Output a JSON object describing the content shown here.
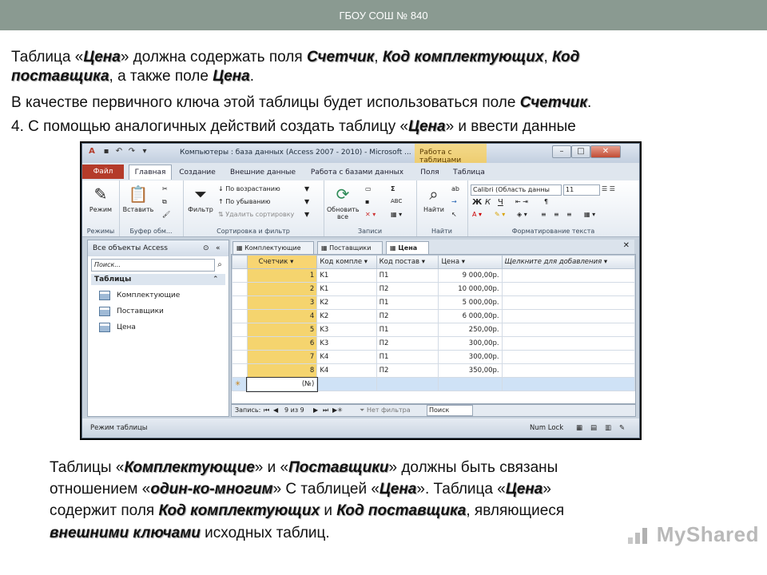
{
  "slide": {
    "header": "ГБОУ СОШ № 840",
    "intro": {
      "l1": [
        "Таблица «",
        "Цена",
        "» должна содержать поля ",
        "Счетчик",
        ", ",
        "Код комплектующих",
        ", ",
        "Код"
      ],
      "l2": [
        "поставщика",
        ", а также поле ",
        "Цена",
        "."
      ],
      "l3": [
        "В качестве первичного ключа этой таблицы будет использоваться поле ",
        "Счетчик",
        "."
      ],
      "l4": [
        " 4. С помощью аналогичных действий создать таблицу «",
        "Цена",
        "» и ввести данные"
      ]
    },
    "outro": {
      "l1": [
        "Таблицы «",
        "Комплектующие",
        "» и «",
        "Поставщики",
        "» должны быть связаны"
      ],
      "l2": [
        "отношением «",
        "один-ко-многим",
        "» С таблицей «",
        "Цена",
        "». Таблица «",
        "Цена",
        "»"
      ],
      "l3": [
        "содержит поля ",
        "Код комплектующих",
        " и ",
        "Код поставщика",
        ", являющиеся"
      ],
      "l4": [
        "внешними ключами",
        " исходных таблиц."
      ]
    },
    "watermark": "MyShared"
  },
  "access": {
    "title": "Компьютеры : база данных (Access 2007 - 2010) - Microsoft ...",
    "context_tab": "Работа с таблицами",
    "tabs": [
      "Файл",
      "Главная",
      "Создание",
      "Внешние данные",
      "Работа с базами данных",
      "Поля",
      "Таблица"
    ],
    "ribbon": {
      "views": {
        "button": "Режим",
        "group": "Режимы"
      },
      "clipboard": {
        "button": "Вставить",
        "group": "Буфер обм..."
      },
      "sort": {
        "filter": "Фильтр",
        "asc": "По возрастанию",
        "desc": "По убыванию",
        "remove": "Удалить сортировку",
        "group": "Сортировка и фильтр"
      },
      "records": {
        "refresh": "Обновить",
        "all": "все",
        "group": "Записи",
        "sum": "Σ",
        "abc": "ABC"
      },
      "find": {
        "button": "Найти",
        "group": "Найти"
      },
      "format": {
        "font": "Calibri (Область данны",
        "size": "11",
        "bold": "Ж",
        "italic": "К",
        "underline": "Ч",
        "group": "Форматирование текста"
      }
    },
    "nav": {
      "header": "Все объекты Access",
      "search_placeholder": "Поиск...",
      "group": "Таблицы",
      "items": [
        "Комплектующие",
        "Поставщики",
        "Цена"
      ]
    },
    "doc_tabs": [
      "Комплектующие",
      "Поставщики",
      "Цена"
    ],
    "columns": [
      "Счетчик",
      "Код компле",
      "Код постав",
      "Цена",
      "Щелкните для добавления"
    ],
    "rows": [
      [
        "1",
        "K1",
        "П1",
        "9 000,00р."
      ],
      [
        "2",
        "K1",
        "П2",
        "10 000,00р."
      ],
      [
        "3",
        "K2",
        "П1",
        "5 000,00р."
      ],
      [
        "4",
        "K2",
        "П2",
        "6 000,00р."
      ],
      [
        "5",
        "K3",
        "П1",
        "250,00р."
      ],
      [
        "6",
        "K3",
        "П2",
        "300,00р."
      ],
      [
        "7",
        "K4",
        "П1",
        "300,00р."
      ],
      [
        "8",
        "K4",
        "П2",
        "350,00р."
      ]
    ],
    "new_row_marker": "✳",
    "new_row_value": "(№)",
    "record_nav": {
      "label": "Запись:",
      "position": "9 из 9",
      "filter": "Нет фильтра",
      "search": "Поиск"
    },
    "status": {
      "left": "Режим таблицы",
      "numlock": "Num Lock"
    }
  }
}
